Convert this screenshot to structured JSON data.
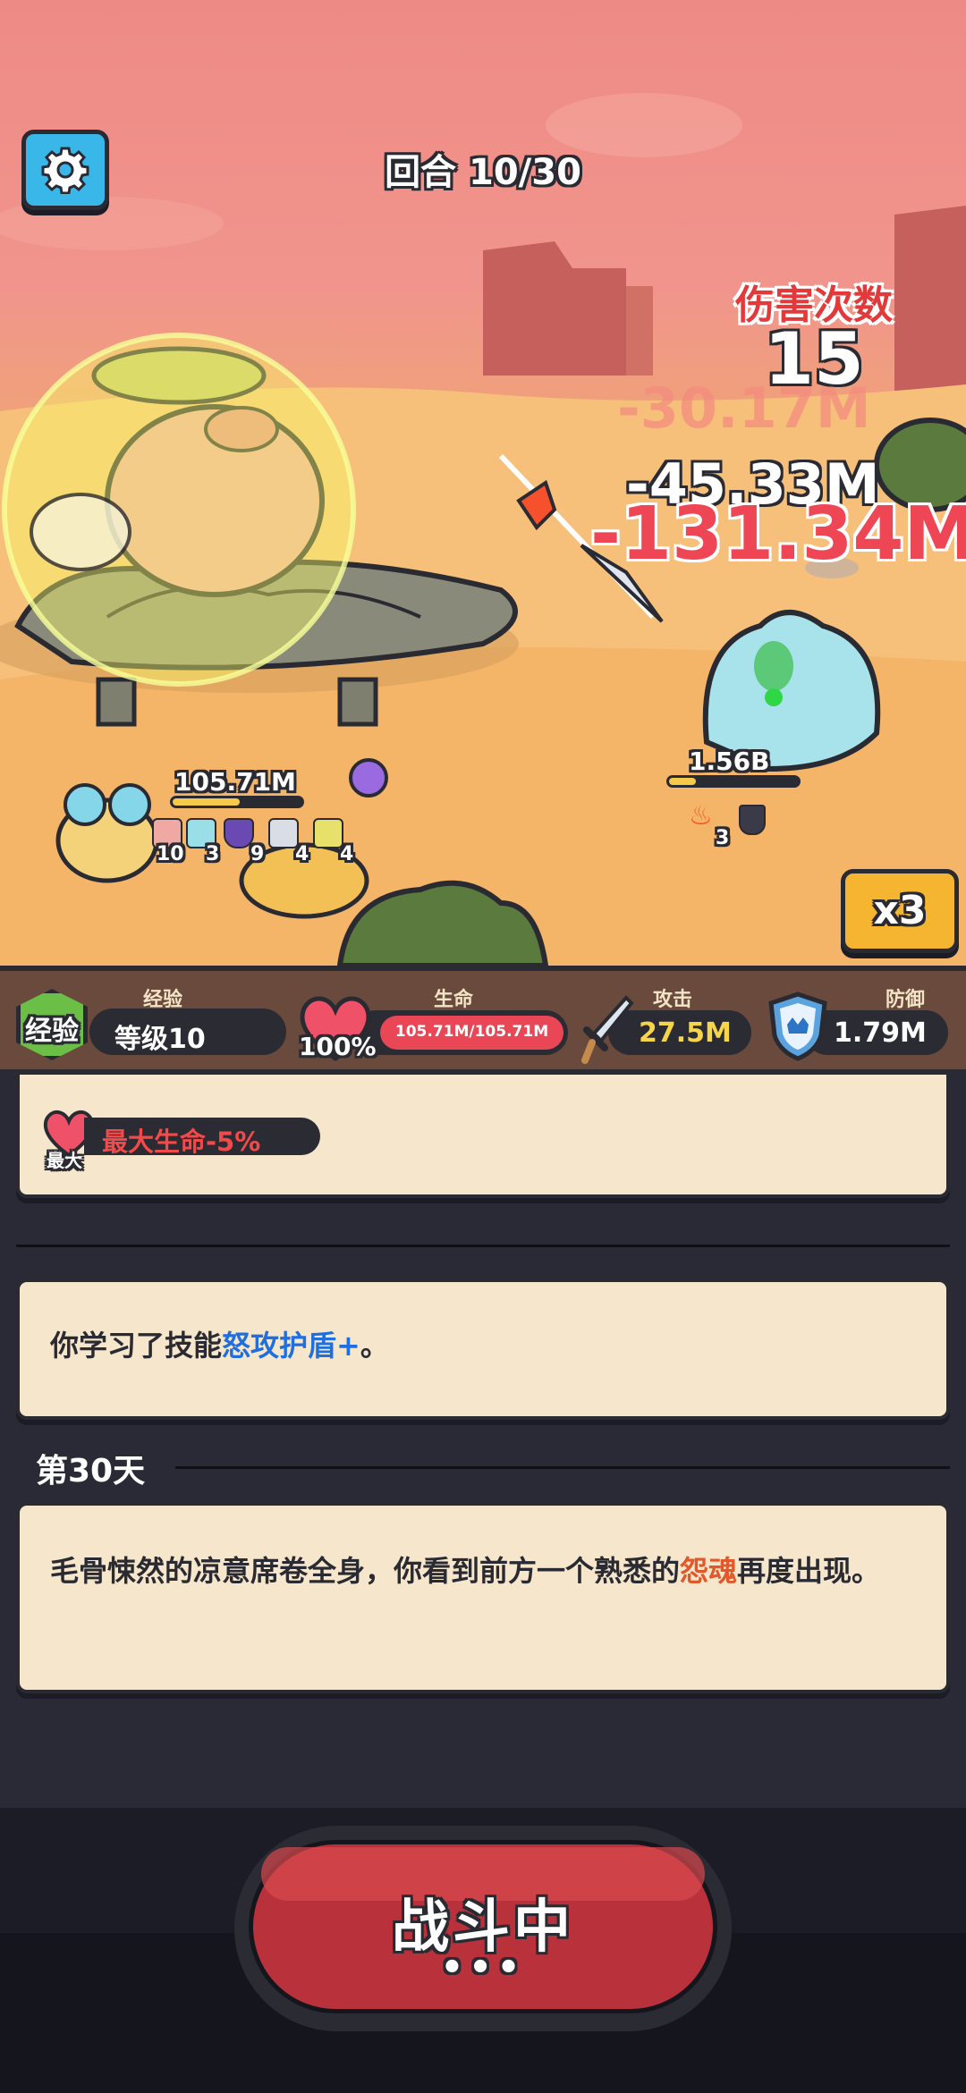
{
  "battle": {
    "round_label": "回合 10/30",
    "hit_count_label": "伤害次数",
    "hit_count": "15",
    "damage_numbers": [
      "-30.17M",
      "-45.33M",
      "-131.34M"
    ],
    "player_hp_label": "105.71M",
    "enemy_hp_label": "1.56B",
    "buff_counts": [
      "10",
      "3",
      "9",
      "4",
      "4"
    ],
    "enemy_status_count": "3",
    "speed_label": "x3"
  },
  "stats": {
    "exp_badge": "经验",
    "exp_title": "经验",
    "level": "等级10",
    "life_title": "生命",
    "life_percent": "100%",
    "life_value": "105.71M/105.71M",
    "life_fill": 1.0,
    "attack_title": "攻击",
    "attack_value": "27.5M",
    "defense_title": "防御",
    "defense_value": "1.79M"
  },
  "log": {
    "card1": {
      "badge_small": "最大",
      "text": "最大生命-5%"
    },
    "card2": {
      "prefix": "你学习了技能",
      "skill": "怒攻护盾+",
      "suffix": "。"
    },
    "day_label": "第30天",
    "card3": {
      "prefix": "毛骨悚然的凉意席卷全身，你看到前方一个熟悉的",
      "highlight": "怨魂",
      "suffix": "再度出现。"
    }
  },
  "footer": {
    "button_label": "战斗中",
    "dots": "•••"
  },
  "colors": {
    "accent_blue": "#1f6fe0",
    "accent_orange": "#e2582b",
    "hp_red": "#ea4756",
    "attack_yellow": "#f7d54a"
  }
}
